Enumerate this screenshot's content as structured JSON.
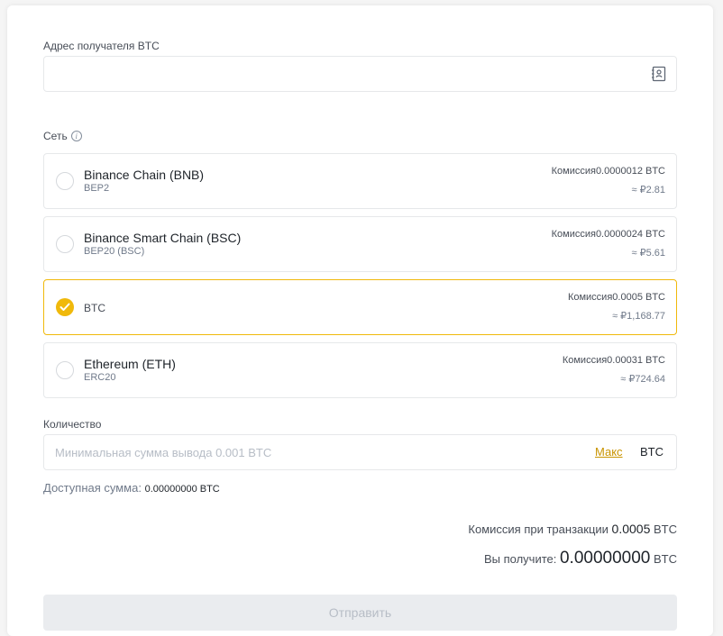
{
  "address": {
    "label": "Адрес получателя BTC",
    "value": "",
    "placeholder": ""
  },
  "network": {
    "label": "Сеть",
    "items": [
      {
        "name": "Binance Chain (BNB)",
        "sub": "BEP2",
        "fee": "Комиссия0.0000012 BTC",
        "fiat": "≈ ₽2.81",
        "selected": false
      },
      {
        "name": "Binance Smart Chain (BSC)",
        "sub": "BEP20 (BSC)",
        "fee": "Комиссия0.0000024 BTC",
        "fiat": "≈ ₽5.61",
        "selected": false
      },
      {
        "name": "BTC",
        "sub": "",
        "fee": "Комиссия0.0005 BTC",
        "fiat": "≈ ₽1,168.77",
        "selected": true
      },
      {
        "name": "Ethereum (ETH)",
        "sub": "ERC20",
        "fee": "Комиссия0.00031 BTC",
        "fiat": "≈ ₽724.64",
        "selected": false
      }
    ]
  },
  "amount": {
    "label": "Количество",
    "placeholder": "Минимальная сумма вывода 0.001 BTC",
    "value": "",
    "max_label": "Макс",
    "unit": "BTC"
  },
  "available": {
    "label": "Доступная сумма:",
    "value": "0.00000000 BTC"
  },
  "summary": {
    "fee_label": "Комиссия при транзакции",
    "fee_value": "0.0005",
    "fee_unit": "BTC",
    "receive_label": "Вы получите:",
    "receive_value": "0.00000000",
    "receive_unit": "BTC"
  },
  "submit": {
    "label": "Отправить"
  },
  "colors": {
    "accent": "#f0b90b",
    "link": "#c99400",
    "border": "#e6e8ea"
  }
}
